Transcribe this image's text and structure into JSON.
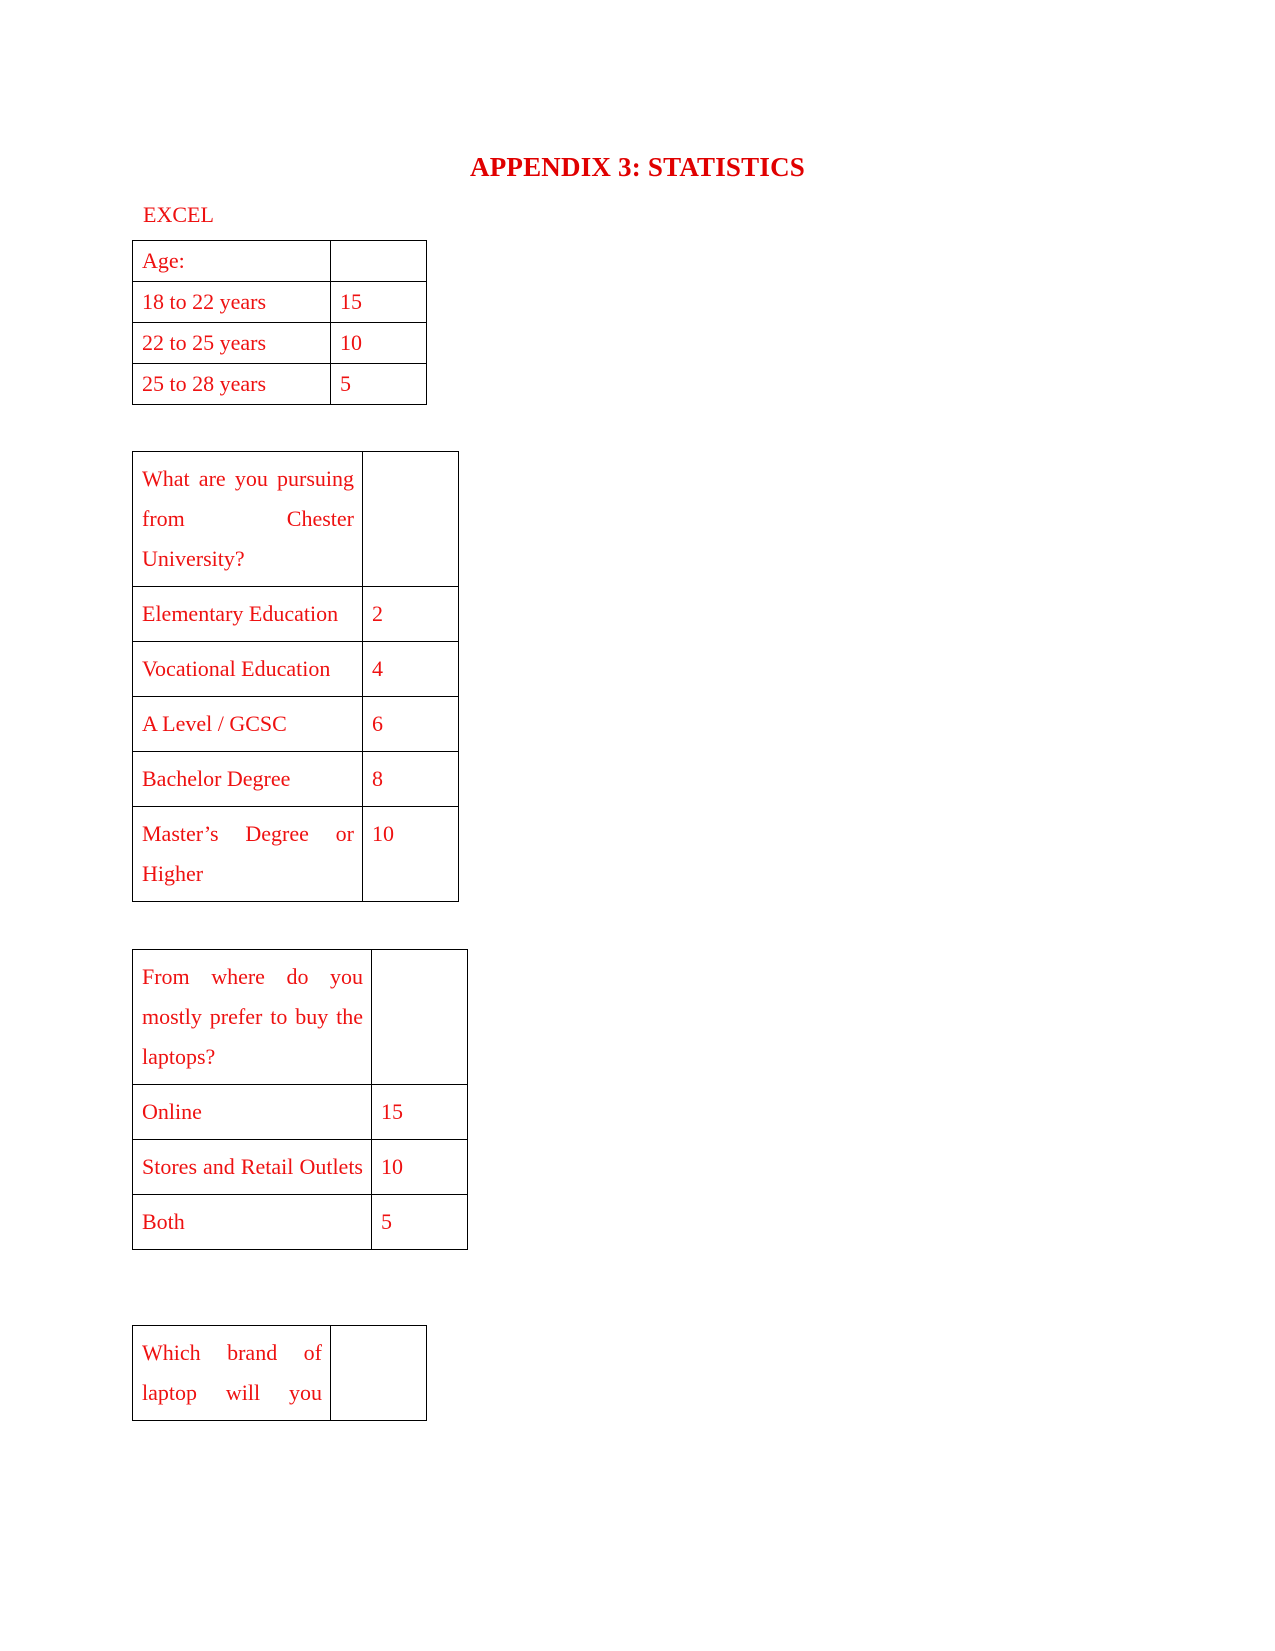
{
  "document": {
    "title": "APPENDIX 3: STATISTICS",
    "section_label": "EXCEL"
  },
  "tables": {
    "age": {
      "header_label": "Age:",
      "header_value": "",
      "rows": [
        {
          "label": "18 to 22 years",
          "value": "15"
        },
        {
          "label": "22 to 25 years",
          "value": "10"
        },
        {
          "label": "25 to 28 years",
          "value": "5"
        }
      ]
    },
    "pursuing": {
      "header_label": "What are you pursuing from Chester University?",
      "header_value": "",
      "rows": [
        {
          "label": "Elementary Education",
          "value": "2"
        },
        {
          "label": "Vocational Education",
          "value": "4"
        },
        {
          "label": "A Level / GCSC",
          "value": "6"
        },
        {
          "label": "Bachelor Degree",
          "value": "8"
        },
        {
          "label": "Master’s Degree or Higher",
          "value": "10"
        }
      ]
    },
    "buy": {
      "header_label": "From where do you mostly prefer to buy the laptops?",
      "header_value": "",
      "rows": [
        {
          "label": "Online",
          "value": "15"
        },
        {
          "label": "Stores and Retail Outlets",
          "value": "10"
        },
        {
          "label": "Both",
          "value": "5"
        }
      ]
    },
    "brand": {
      "header_label": "Which brand of laptop will you",
      "header_value": ""
    }
  },
  "chart_data": {
    "type": "table",
    "title": "APPENDIX 3: STATISTICS",
    "tables": [
      {
        "title": "Age:",
        "categories": [
          "18 to 22 years",
          "22 to 25 years",
          "25 to 28 years"
        ],
        "values": [
          15,
          10,
          5
        ]
      },
      {
        "title": "What are you pursuing from Chester University?",
        "categories": [
          "Elementary Education",
          "Vocational Education",
          "A Level / GCSC",
          "Bachelor Degree",
          "Master’s Degree or Higher"
        ],
        "values": [
          2,
          4,
          6,
          8,
          10
        ]
      },
      {
        "title": "From where do you mostly prefer to buy the laptops?",
        "categories": [
          "Online",
          "Stores and Retail Outlets",
          "Both"
        ],
        "values": [
          15,
          10,
          5
        ]
      },
      {
        "title": "Which brand of laptop will you",
        "categories": [],
        "values": []
      }
    ]
  }
}
